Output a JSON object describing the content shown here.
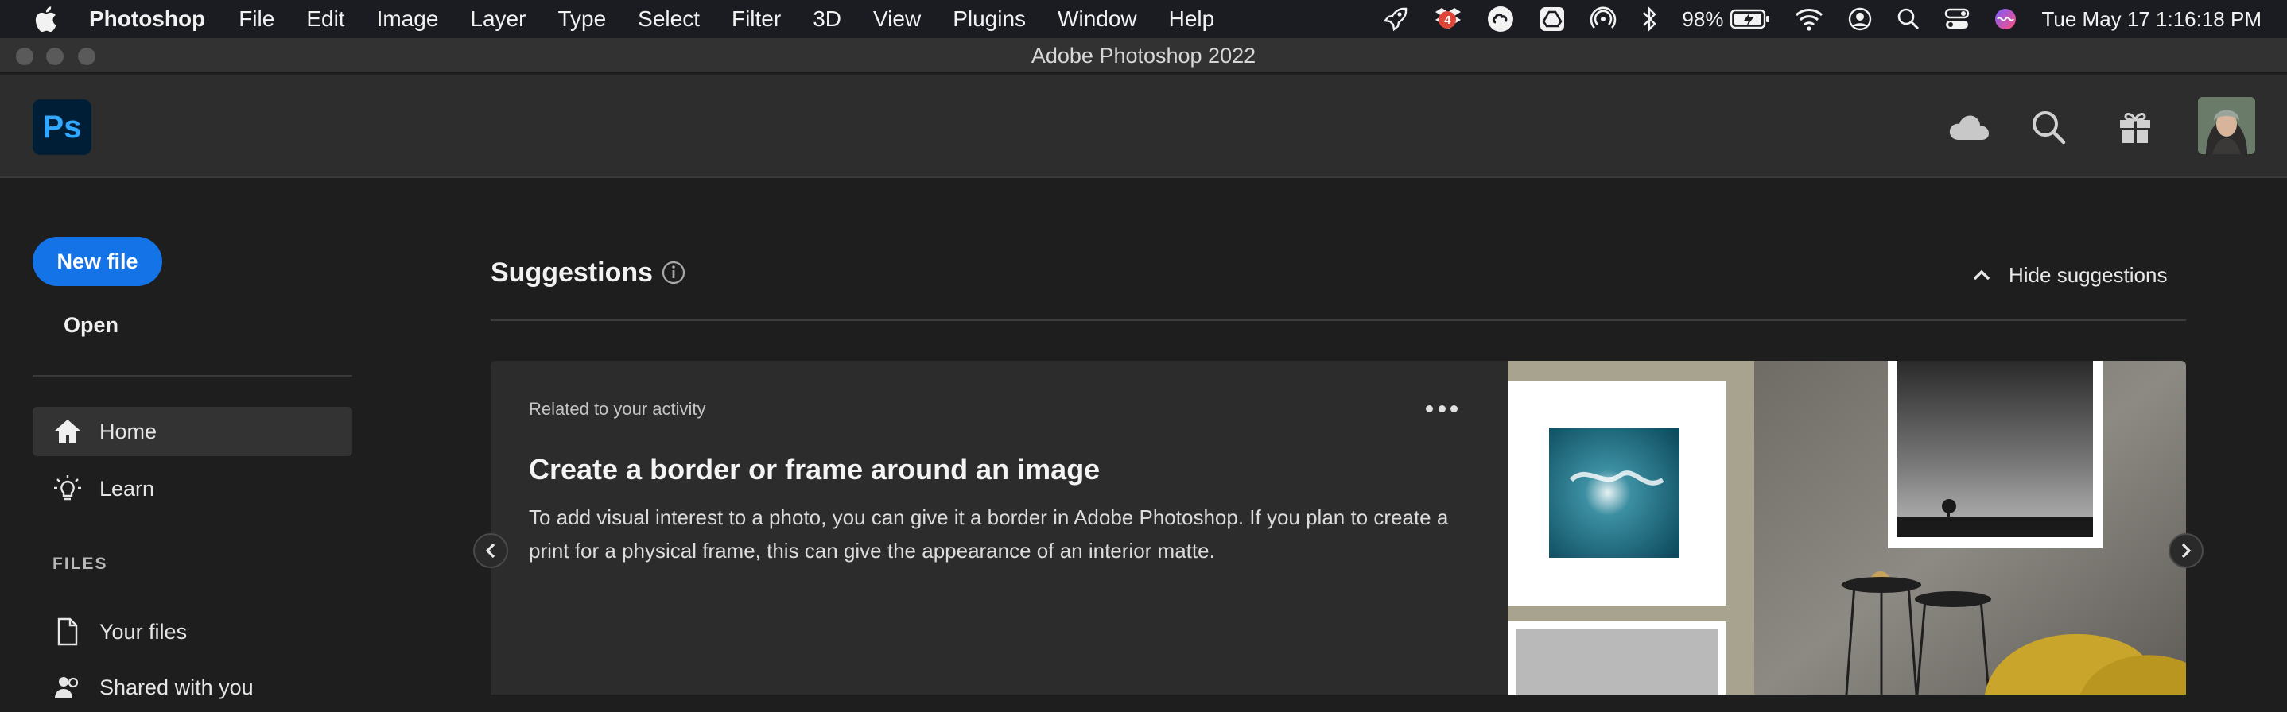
{
  "menubar": {
    "app_name": "Photoshop",
    "items": [
      "File",
      "Edit",
      "Image",
      "Layer",
      "Type",
      "Select",
      "Filter",
      "3D",
      "View",
      "Plugins",
      "Window",
      "Help"
    ],
    "notification_badge": "4",
    "battery_percent": "98%",
    "datetime": "Tue May 17  1:16:18 PM"
  },
  "window": {
    "title": "Adobe Photoshop 2022"
  },
  "header": {
    "logo_text": "Ps",
    "icons": [
      "cloud-icon",
      "search-icon",
      "gift-icon"
    ]
  },
  "sidebar": {
    "new_file_label": "New file",
    "open_label": "Open",
    "nav": [
      {
        "label": "Home",
        "icon": "home-icon",
        "active": true
      },
      {
        "label": "Learn",
        "icon": "lightbulb-icon",
        "active": false
      }
    ],
    "files_section_label": "FILES",
    "files_nav": [
      {
        "label": "Your files",
        "icon": "document-icon"
      },
      {
        "label": "Shared with you",
        "icon": "people-icon"
      }
    ]
  },
  "suggestions": {
    "title": "Suggestions",
    "hide_label": "Hide suggestions",
    "card": {
      "eyebrow": "Related to your activity",
      "title": "Create a border or frame around an image",
      "description": "To add visual interest to a photo, you can give it a border in Adobe Photoshop. If you plan to create a print for a physical frame, this can give the appearance of an interior matte."
    }
  },
  "colors": {
    "accent_blue": "#1473e6",
    "ps_logo_bg": "#001e36",
    "ps_logo_text": "#31a8ff"
  }
}
